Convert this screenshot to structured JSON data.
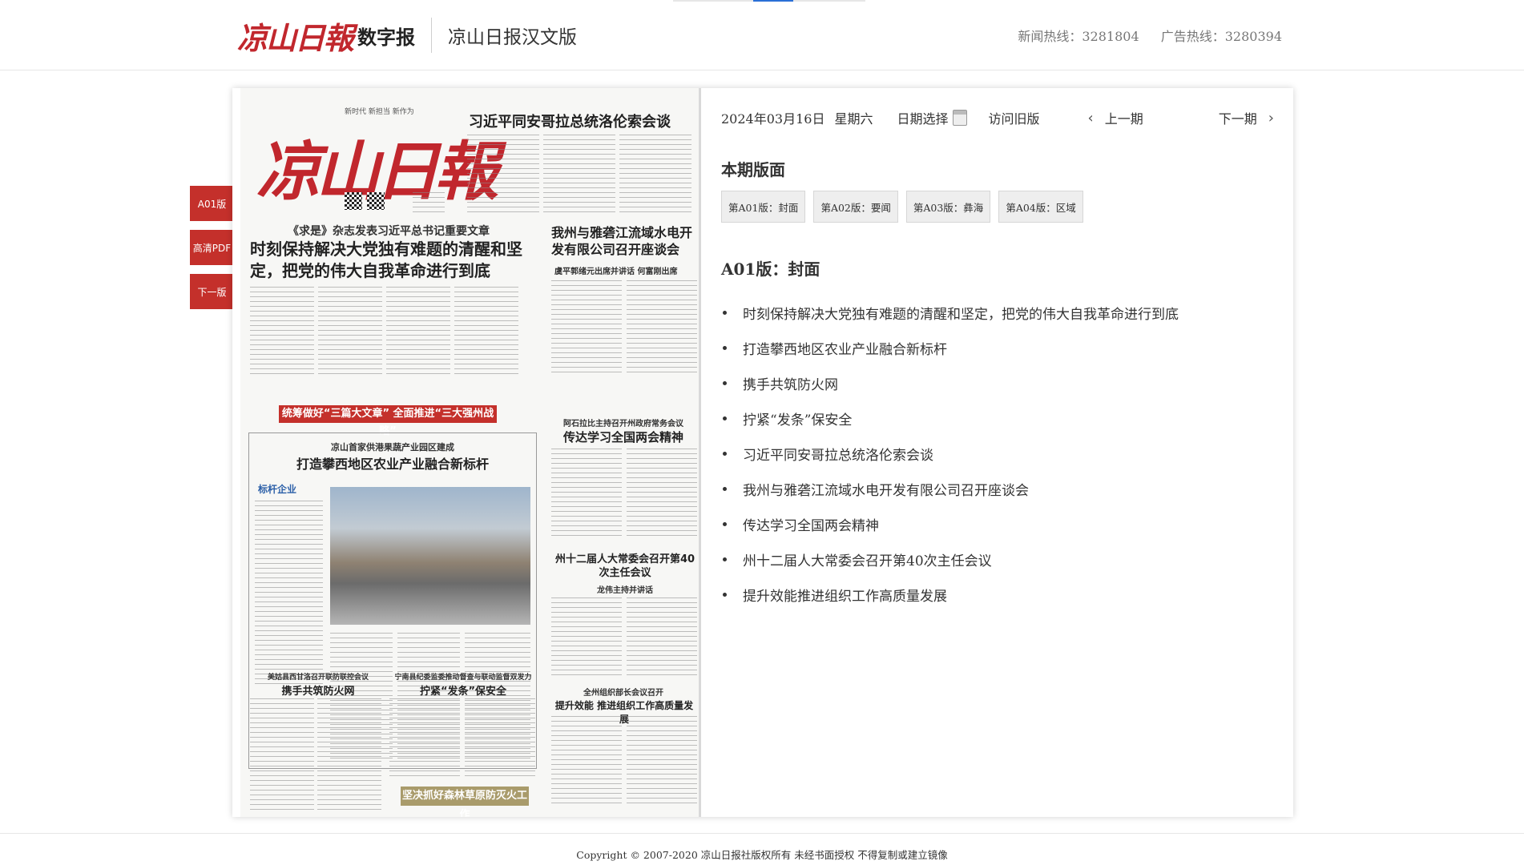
{
  "header": {
    "logo_text": "凉山日報",
    "digital_label": "数字报",
    "edition": "凉山日报汉文版",
    "news_hotline": "新闻热线：3281804",
    "ad_hotline": "广告热线：3280394"
  },
  "side_tabs": [
    "A01版",
    "高清PDF",
    "下一版"
  ],
  "newspaper": {
    "masthead": "凉山日報",
    "slogan": "新时代 新担当 新作为",
    "headline_top": "习近平同安哥拉总统洛伦索会谈",
    "kicker_main": "《求是》杂志发表习近平总书记重要文章",
    "headline_main": "时刻保持解决大党独有难题的清醒和坚定，把党的伟大自我革命进行到底",
    "headline_right": "我州与雅砻江流域水电开发有限公司召开座谈会",
    "sub_right": "虞平郭绪元出席并讲话 何富刚出席",
    "red_bar": "统筹做好“三篇大文章” 全面推进“三大强州战略”",
    "kicker_industry": "凉山首家供港果蔬产业园区建成",
    "headline_industry": "打造攀西地区农业产业融合新标杆",
    "label_enterprise": "标杆企业",
    "kicker_twosessions": "阿石拉比主持召开州政府常务会议",
    "headline_twosessions": "传达学习全国两会精神",
    "headline_congress": "州十二届人大常委会召开第40次主任会议",
    "sub_congress": "龙伟主持并讲话",
    "kicker_fire": "美姑县西甘洛召开联防联控会议",
    "headline_fire": "携手共筑防火网",
    "kicker_fa": "宁南县纪委监委推动督查与联动监督双发力",
    "headline_fa": "拧紧“发条”保安全",
    "kicker_org": "全州组织部长会议召开",
    "headline_org": "提升效能 推进组织工作高质量发展",
    "banner_fire": "坚决抓好森林草原防灭火工作"
  },
  "nav": {
    "date": "2024年03月16日",
    "weekday": "星期六",
    "date_pick": "日期选择",
    "old_version": "访问旧版",
    "prev": "上一期",
    "next": "下一期"
  },
  "sections_title": "本期版面",
  "pages": [
    "第A01版：封面",
    "第A02版：要闻",
    "第A03版：彝海",
    "第A04版：区域"
  ],
  "current_page_title": "A01版：封面",
  "articles": [
    "时刻保持解决大党独有难题的清醒和坚定，把党的伟大自我革命进行到底",
    "打造攀西地区农业产业融合新标杆",
    "携手共筑防火网",
    "拧紧“发条”保安全",
    "习近平同安哥拉总统洛伦索会谈",
    "我州与雅砻江流域水电开发有限公司召开座谈会",
    "传达学习全国两会精神",
    "州十二届人大常委会召开第40次主任会议",
    "提升效能推进组织工作高质量发展"
  ],
  "footer": "Copyright © 2007-2020 凉山日报社版权所有 未经书面授权 不得复制或建立镜像",
  "colors": {
    "accent_red": "#c4302b",
    "logo_red": "#c1272d"
  }
}
